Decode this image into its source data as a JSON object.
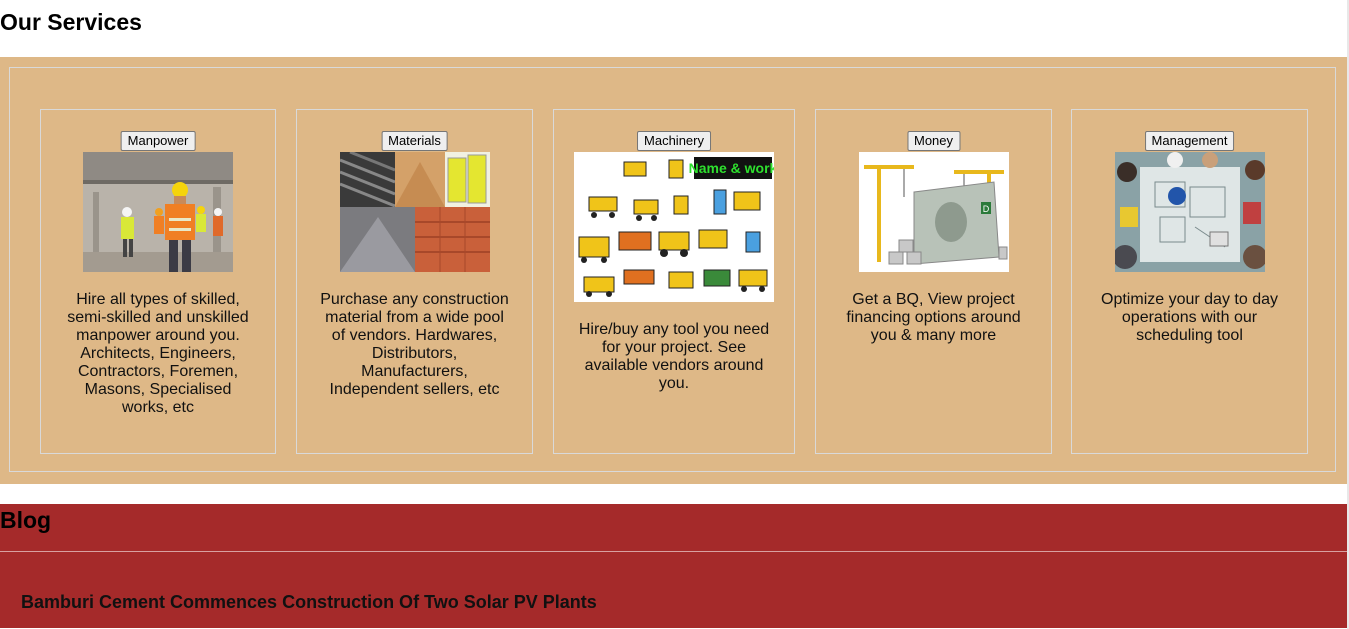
{
  "services": {
    "title": "Our Services",
    "cards": [
      {
        "button_label": "Manpower",
        "description": "Hire all types of skilled, semi-skilled and unskilled manpower around you. Architects, Engineers, Contractors, Foremen, Masons, Specialised works, etc",
        "image_icon": "construction-workers-image"
      },
      {
        "button_label": "Materials",
        "description": "Purchase any construction material from a wide pool of vendors. Hardwares, Distributors, Manufacturers, Independent sellers, etc",
        "image_icon": "building-materials-image"
      },
      {
        "button_label": "Machinery",
        "description": "Hire/buy any tool you need for your project. See available vendors around you.",
        "image_icon": "construction-machinery-image",
        "image_label": "Name & work"
      },
      {
        "button_label": "Money",
        "description": "Get a BQ, View project financing options around you & many more",
        "image_icon": "money-cranes-image"
      },
      {
        "button_label": "Management",
        "description": "Optimize your day to day operations with our scheduling tool",
        "image_icon": "team-meeting-image"
      }
    ]
  },
  "blog": {
    "title": "Blog",
    "posts": [
      {
        "title": "Bamburi Cement Commences Construction Of Two Solar PV Plants"
      }
    ]
  },
  "colors": {
    "services_bg": "#deb887",
    "blog_bg": "#a52a2a"
  }
}
